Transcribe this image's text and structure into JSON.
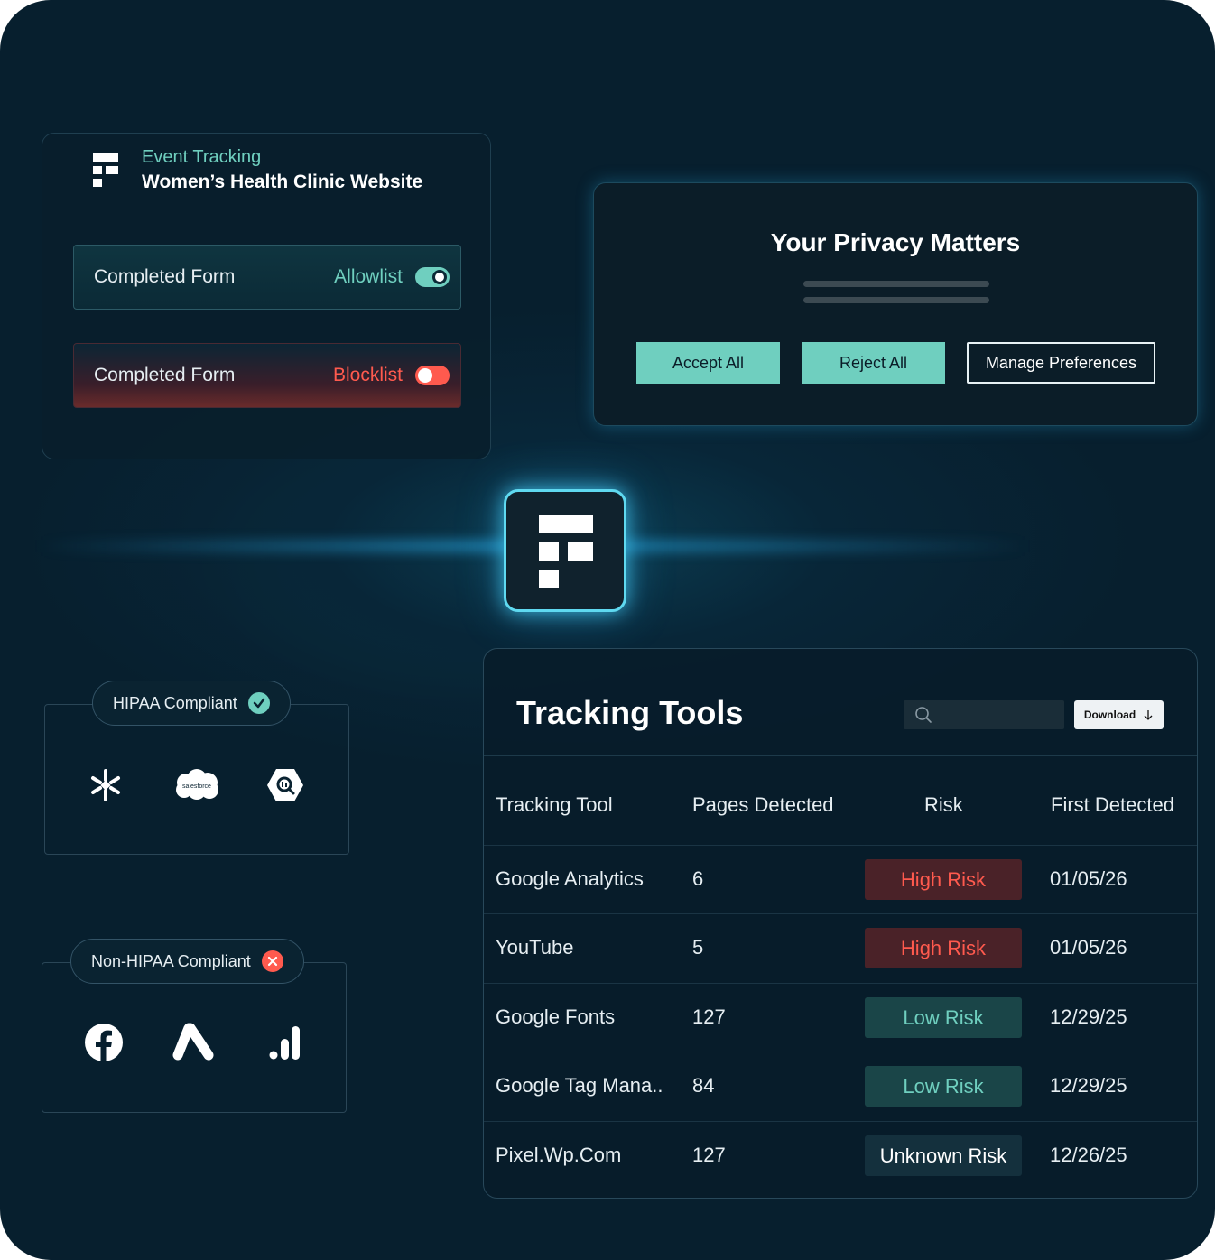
{
  "event_tracking": {
    "kicker": "Event Tracking",
    "title": "Women’s Health Clinic Website",
    "rules": [
      {
        "name": "Completed Form",
        "status": "Allowlist",
        "toggle_on": true
      },
      {
        "name": "Completed Form",
        "status": "Blocklist",
        "toggle_on": false
      }
    ]
  },
  "privacy_banner": {
    "title": "Your Privacy Matters",
    "accept_label": "Accept All",
    "reject_label": "Reject All",
    "manage_label": "Manage Preferences"
  },
  "compliance": {
    "hipaa_label": "HIPAA Compliant",
    "hipaa_icons": [
      "snowflake-icon",
      "salesforce-icon",
      "bigquery-icon"
    ],
    "salesforce_text": "salesforce",
    "non_hipaa_label": "Non-HIPAA Compliant",
    "non_hipaa_icons": [
      "facebook-icon",
      "google-ads-icon",
      "google-analytics-icon"
    ]
  },
  "tracking_tools": {
    "title": "Tracking Tools",
    "search_placeholder": "",
    "download_label": "Download",
    "columns": [
      "Tracking Tool",
      "Pages Detected",
      "Risk",
      "First Detected"
    ],
    "rows": [
      {
        "tool": "Google Analytics",
        "pages": "6",
        "risk": "High Risk",
        "risk_level": "high",
        "first": "01/05/26"
      },
      {
        "tool": "YouTube",
        "pages": "5",
        "risk": "High Risk",
        "risk_level": "high",
        "first": "01/05/26"
      },
      {
        "tool": "Google Fonts",
        "pages": "127",
        "risk": "Low Risk",
        "risk_level": "low",
        "first": "12/29/25"
      },
      {
        "tool": "Google Tag Mana..",
        "pages": "84",
        "risk": "Low Risk",
        "risk_level": "low",
        "first": "12/29/25"
      },
      {
        "tool": "Pixel.Wp.Com",
        "pages": "127",
        "risk": "Unknown Risk",
        "risk_level": "unknown",
        "first": "12/26/25"
      }
    ]
  },
  "colors": {
    "accent": "#6fcfbf",
    "danger": "#ff5a4e",
    "background": "#071f2e"
  }
}
